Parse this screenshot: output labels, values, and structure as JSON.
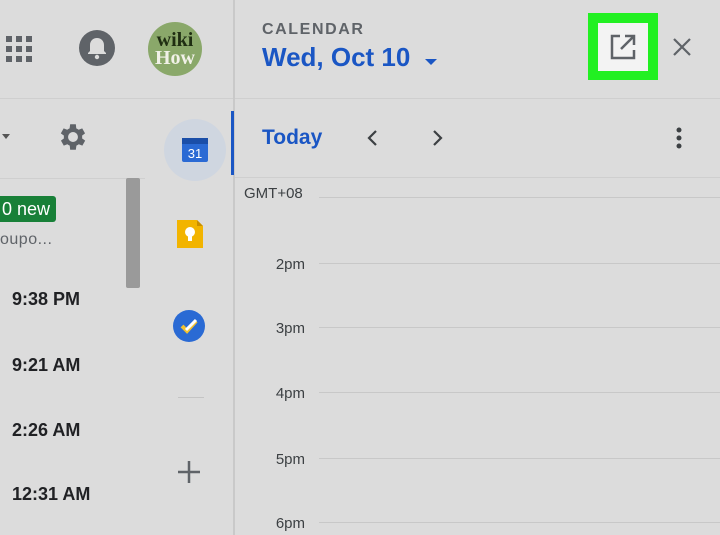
{
  "mail": {
    "new_badge": "0 new",
    "snippet": "oupo...",
    "times": [
      "9:38 PM",
      "9:21 AM",
      "2:26 AM",
      "12:31 AM"
    ]
  },
  "avatar": {
    "line1": "wiki",
    "line2": "How"
  },
  "calendar": {
    "header_label": "CALENDAR",
    "date": "Wed, Oct 10",
    "today_label": "Today",
    "calendar_badge": "31",
    "timezone": "GMT+08",
    "hours": [
      "2pm",
      "3pm",
      "4pm",
      "5pm",
      "6pm"
    ]
  },
  "icons": {
    "apps": "apps-grid-icon",
    "notifications": "bell-icon",
    "settings": "gear-icon",
    "calendar": "calendar-icon",
    "keep": "keep-bulb-icon",
    "tasks": "tasks-check-icon",
    "add": "plus-icon",
    "open_new_window": "open-in-new-icon",
    "close": "close-icon",
    "prev": "chevron-left-icon",
    "next": "chevron-right-icon",
    "more": "more-vert-icon"
  },
  "colors": {
    "accent_blue": "#1a56c4",
    "highlight_green": "#22f022",
    "badge_green": "#188038",
    "keep_yellow": "#f2b400"
  }
}
